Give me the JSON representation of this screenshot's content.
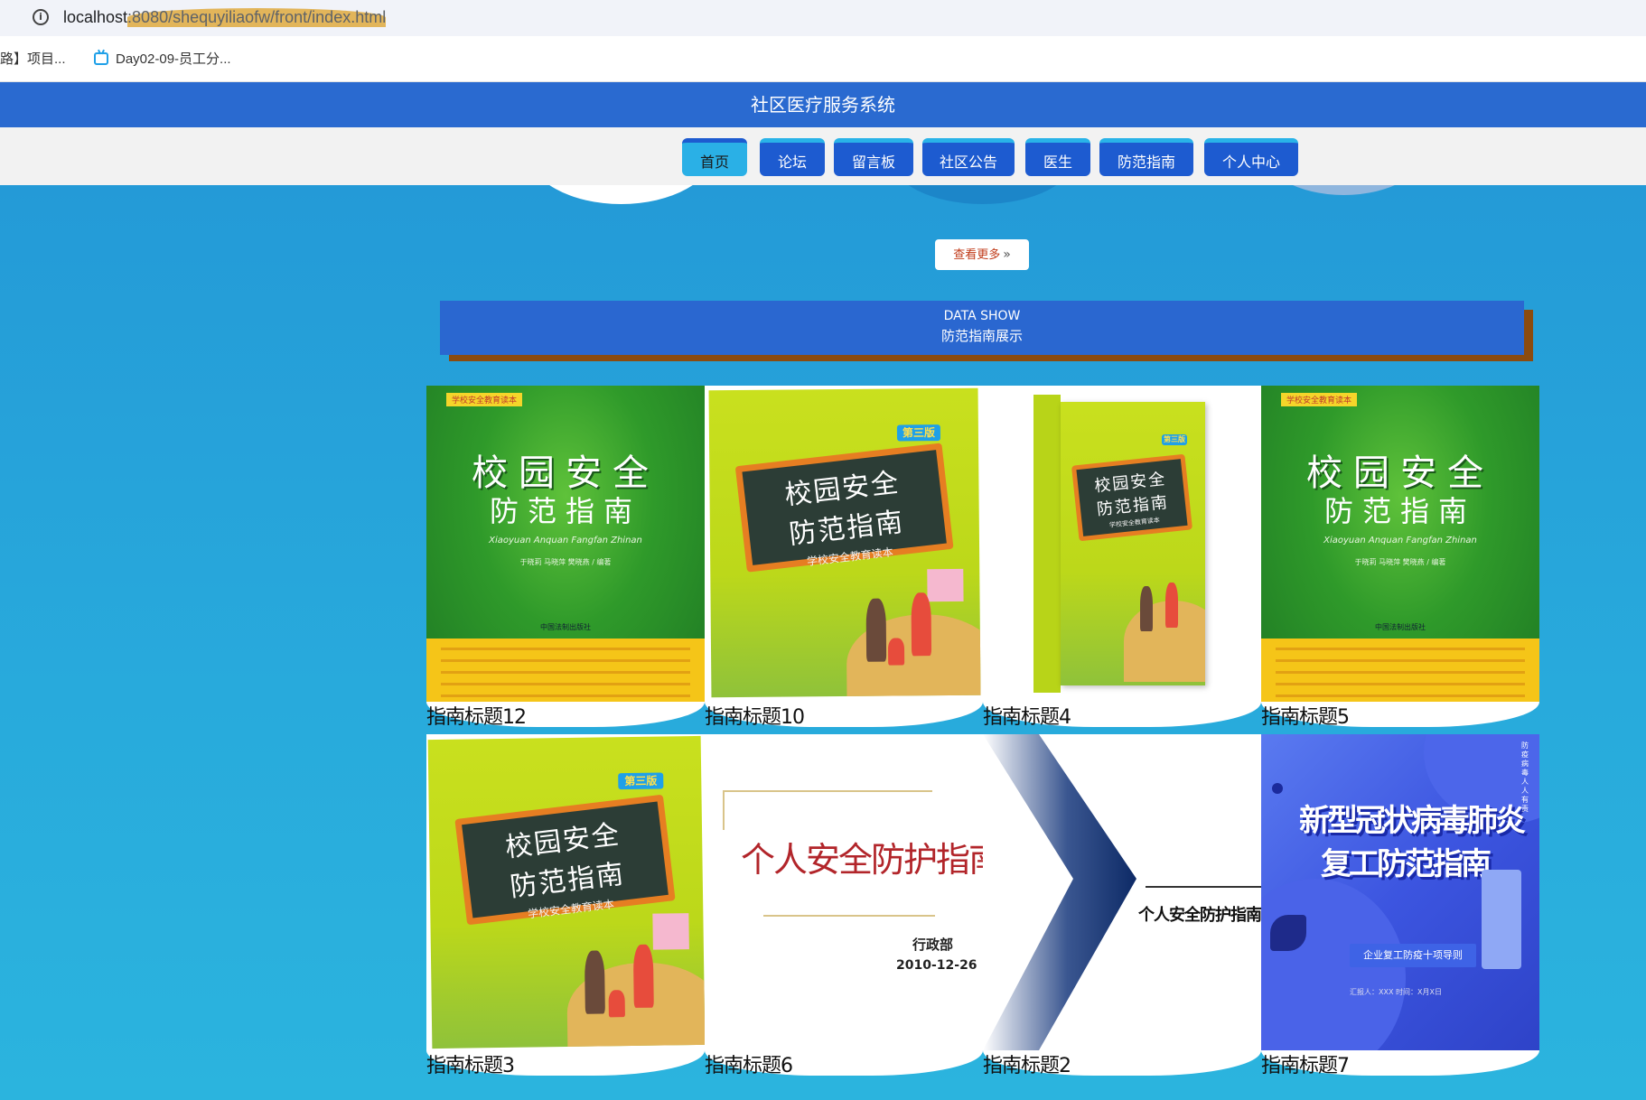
{
  "browser": {
    "url_host": "localhost",
    "url_path": ":8080/shequyiliaofw/front/index.html",
    "bookmarks": [
      "路】项目...",
      "Day02-09-员工分..."
    ]
  },
  "site": {
    "title": "社区医疗服务系统"
  },
  "nav": {
    "items": [
      "首页",
      "论坛",
      "留言板",
      "社区公告",
      "医生",
      "防范指南",
      "个人中心"
    ],
    "active_index": 0
  },
  "more_button": {
    "label": "查看更多",
    "arrow": "»"
  },
  "section": {
    "title_en": "DATA SHOW",
    "title_cn": "防范指南展示"
  },
  "cards": [
    {
      "caption": "指南标题12",
      "cover": "green"
    },
    {
      "caption": "指南标题10",
      "cover": "lime-board"
    },
    {
      "caption": "指南标题4",
      "cover": "lime-book-3d"
    },
    {
      "caption": "指南标题5",
      "cover": "green"
    },
    {
      "caption": "指南标题3",
      "cover": "lime-board"
    },
    {
      "caption": "指南标题6",
      "cover": "slide"
    },
    {
      "caption": "指南标题2",
      "cover": "slide-arrow"
    },
    {
      "caption": "指南标题7",
      "cover": "blue"
    }
  ],
  "covers": {
    "green": {
      "tag": "学校安全教育读本",
      "line1": "校园安全",
      "line2": "防范指南",
      "pinyin": "Xiaoyuan Anquan Fangfan Zhinan",
      "authors": "于晓莉  马晓萍  樊晓燕 / 编著",
      "publisher": "中国法制出版社"
    },
    "lime": {
      "line1": "校园安全",
      "line2": "防范指南",
      "sub": "学校安全教育读本",
      "badge": "第三版"
    },
    "slide": {
      "title": "个人安全防护指南",
      "dept": "行政部",
      "date": "2010-12-26",
      "small": "个人安全防护指南"
    },
    "blue": {
      "line1": "新型冠状病毒肺炎",
      "line2": "复工防范指南",
      "pill": "企业复工防疫十项导则",
      "meta": "汇报人：XXX    时间：X月X日",
      "side": "防疫病毒人人有责"
    }
  },
  "colors": {
    "header": "#2a6ad0",
    "nav_button": "#1d5bd0",
    "nav_active": "#2ab0e6",
    "section_shadow": "#8b4b10",
    "page_bg": "#2aa6dc"
  }
}
